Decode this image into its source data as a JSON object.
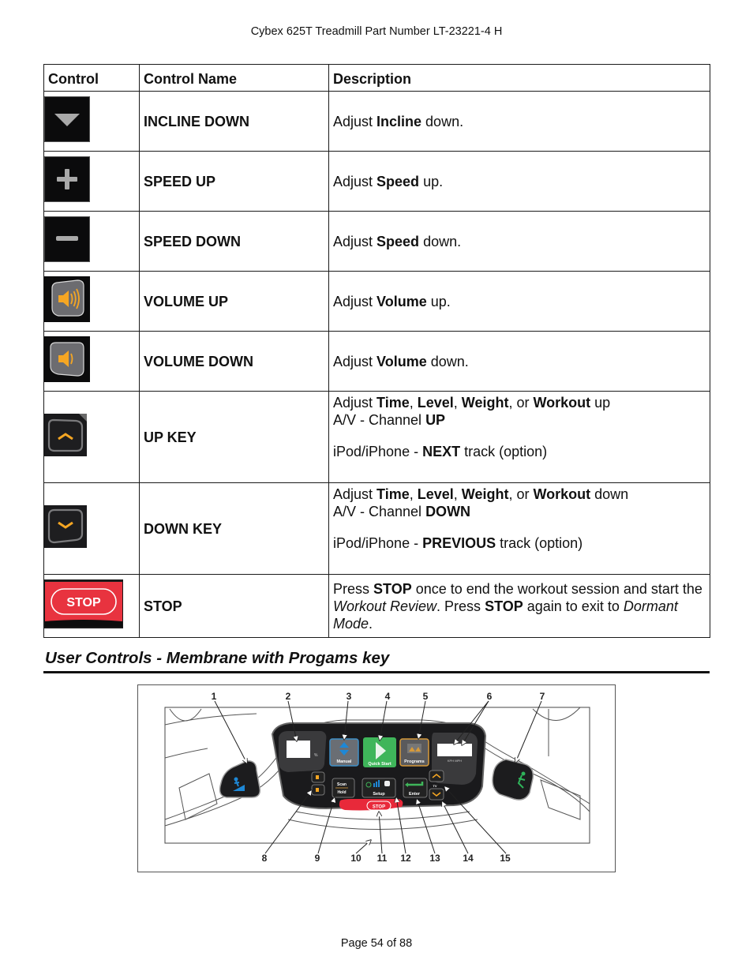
{
  "header": {
    "title": "Cybex 625T Treadmill Part Number LT-23221-4 H"
  },
  "table": {
    "columns": [
      "Control",
      "Control Name",
      "Description"
    ],
    "rows": [
      {
        "icon": "incline-down-icon",
        "name": "INCLINE DOWN",
        "desc": [
          {
            "t": "Adjust "
          },
          {
            "t": "Incline",
            "b": true
          },
          {
            "t": " down."
          }
        ]
      },
      {
        "icon": "speed-up-icon",
        "name": "SPEED UP",
        "desc": [
          {
            "t": "Adjust "
          },
          {
            "t": "Speed",
            "b": true
          },
          {
            "t": " up."
          }
        ]
      },
      {
        "icon": "speed-down-icon",
        "name": "SPEED DOWN",
        "desc": [
          {
            "t": "Adjust "
          },
          {
            "t": "Speed",
            "b": true
          },
          {
            "t": " down."
          }
        ]
      },
      {
        "icon": "volume-up-icon",
        "name": "VOLUME UP",
        "desc": [
          {
            "t": "Adjust "
          },
          {
            "t": "Volume",
            "b": true
          },
          {
            "t": " up."
          }
        ]
      },
      {
        "icon": "volume-down-icon",
        "name": "VOLUME DOWN",
        "desc": [
          {
            "t": "Adjust "
          },
          {
            "t": "Volume",
            "b": true
          },
          {
            "t": " down."
          }
        ]
      },
      {
        "icon": "up-key-icon",
        "name": "UP KEY",
        "lines": [
          [
            {
              "t": "Adjust "
            },
            {
              "t": "Time",
              "b": true
            },
            {
              "t": ", "
            },
            {
              "t": "Level",
              "b": true
            },
            {
              "t": ", "
            },
            {
              "t": "Weight",
              "b": true
            },
            {
              "t": ", or "
            },
            {
              "t": "Workout",
              "b": true
            },
            {
              "t": " up"
            }
          ],
          [
            {
              "t": "A/V - Channel "
            },
            {
              "t": "UP",
              "b": true
            }
          ],
          [],
          [
            {
              "t": "iPod/iPhone - "
            },
            {
              "t": "NEXT",
              "b": true
            },
            {
              "t": " track (option)"
            }
          ]
        ]
      },
      {
        "icon": "down-key-icon",
        "name": "DOWN KEY",
        "lines": [
          [
            {
              "t": "Adjust "
            },
            {
              "t": "Time",
              "b": true
            },
            {
              "t": ", "
            },
            {
              "t": "Level",
              "b": true
            },
            {
              "t": ", "
            },
            {
              "t": "Weight",
              "b": true
            },
            {
              "t": ", or "
            },
            {
              "t": "Workout",
              "b": true
            },
            {
              "t": " down"
            }
          ],
          [
            {
              "t": "A/V - Channel "
            },
            {
              "t": "DOWN",
              "b": true
            }
          ],
          [],
          [
            {
              "t": "iPod/iPhone - "
            },
            {
              "t": "PREVIOUS",
              "b": true
            },
            {
              "t": " track (option)"
            }
          ]
        ]
      },
      {
        "icon": "stop-icon",
        "icon_label": "STOP",
        "name": "STOP",
        "desc": [
          {
            "t": "Press "
          },
          {
            "t": "STOP",
            "b": true
          },
          {
            "t": " once to end the workout session and start the "
          },
          {
            "t": "Workout Review",
            "i": true
          },
          {
            "t": ". Press "
          },
          {
            "t": "STOP",
            "b": true
          },
          {
            "t": " again to exit to "
          },
          {
            "t": "Dormant Mode",
            "i": true
          },
          {
            "t": "."
          }
        ]
      }
    ]
  },
  "section": {
    "title": "User Controls - Membrane with Progams key"
  },
  "figure": {
    "callouts_top": [
      "1",
      "2",
      "3",
      "4",
      "5",
      "6",
      "7"
    ],
    "callouts_bottom": [
      "8",
      "9",
      "10",
      "11",
      "12",
      "13",
      "14",
      "15"
    ],
    "labels": {
      "manual": "Manual",
      "quick_start": "Quick Start",
      "programs": "Programs",
      "scan": "Scan",
      "hold": "Hold",
      "setup": "Setup",
      "enter": "Enter",
      "tv": "TV",
      "stop": "STOP",
      "percent": "%",
      "units": "KPH  MPH"
    },
    "colors": {
      "manual": "#3e8fc7",
      "quick_start": "#3fb55a",
      "programs": "#d79a3a",
      "stop": "#e8293a",
      "accent_orange": "#f5a623"
    }
  },
  "footer": {
    "page": "Page 54 of 88"
  }
}
